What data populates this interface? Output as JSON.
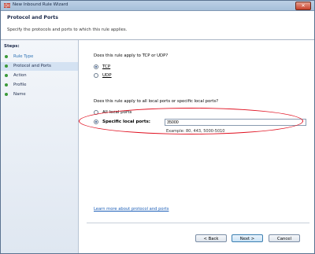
{
  "window": {
    "title": "New Inbound Rule Wizard",
    "close_glyph": "✕"
  },
  "header": {
    "title": "Protocol and Ports",
    "description": "Specify the protocols and ports to which this rule applies."
  },
  "sidebar": {
    "steps_label": "Steps:",
    "steps": [
      {
        "label": "Rule Type",
        "state": "done"
      },
      {
        "label": "Protocol and Ports",
        "state": "current"
      },
      {
        "label": "Action",
        "state": "pending"
      },
      {
        "label": "Profile",
        "state": "pending"
      },
      {
        "label": "Name",
        "state": "pending"
      }
    ]
  },
  "protocol": {
    "question": "Does this rule apply to TCP or UDP?",
    "tcp_label": "TCP",
    "udp_label": "UDP",
    "selected": "TCP"
  },
  "ports": {
    "question": "Does this rule apply to all local ports or specific local ports?",
    "all_label": "All local ports",
    "specific_label": "Specific local ports:",
    "selected": "specific",
    "value": "35000",
    "example": "Example: 80, 443, 5000-5010"
  },
  "links": {
    "learn_more": "Learn more about protocol and ports"
  },
  "buttons": {
    "back": "< Back",
    "next": "Next >",
    "cancel": "Cancel"
  },
  "colors": {
    "highlight_ellipse": "#e01020",
    "step_dot": "#3b9a3b",
    "link": "#1d5fb8"
  }
}
